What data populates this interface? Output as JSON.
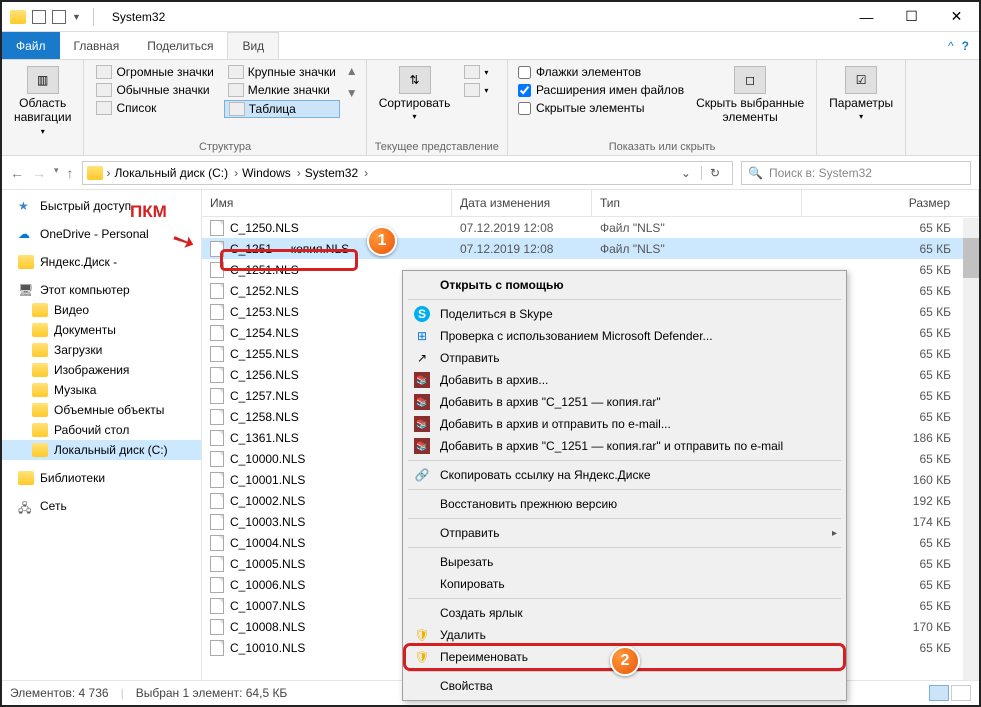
{
  "window": {
    "title": "System32"
  },
  "tabs": {
    "file": "Файл",
    "home": "Главная",
    "share": "Поделиться",
    "view": "Вид"
  },
  "ribbon": {
    "nav_pane": "Область\nнавигации",
    "layout": {
      "huge": "Огромные значки",
      "large": "Крупные значки",
      "normal": "Обычные значки",
      "small": "Мелкие значки",
      "list": "Список",
      "details": "Таблица",
      "label": "Структура"
    },
    "sort": {
      "btn": "Сортировать",
      "label": "Текущее представление"
    },
    "show": {
      "checkboxes": "Флажки элементов",
      "ext": "Расширения имен файлов",
      "hidden": "Скрытые элементы",
      "hide_btn": "Скрыть выбранные\nэлементы",
      "label": "Показать или скрыть"
    },
    "options": "Параметры"
  },
  "breadcrumbs": [
    "Локальный диск (C:)",
    "Windows",
    "System32"
  ],
  "search": {
    "placeholder": "Поиск в: System32"
  },
  "tree": {
    "quick": "Быстрый доступ",
    "onedrive": "OneDrive - Personal",
    "yandex": "Яндекс.Диск -",
    "pc": "Этот компьютер",
    "pc_items": [
      "Видео",
      "Документы",
      "Загрузки",
      "Изображения",
      "Музыка",
      "Объемные объекты",
      "Рабочий стол",
      "Локальный диск (C:)"
    ],
    "libs": "Библиотеки",
    "net": "Сеть"
  },
  "columns": {
    "name": "Имя",
    "date": "Дата изменения",
    "type": "Тип",
    "size": "Размер"
  },
  "files": [
    {
      "n": "C_1250.NLS",
      "d": "07.12.2019 12:08",
      "t": "Файл \"NLS\"",
      "s": "65 КБ",
      "sel": false
    },
    {
      "n": "C_1251 — копия.NLS",
      "d": "07.12.2019 12:08",
      "t": "Файл \"NLS\"",
      "s": "65 КБ",
      "sel": true
    },
    {
      "n": "C_1251.NLS",
      "d": "",
      "t": "",
      "s": "65 КБ"
    },
    {
      "n": "C_1252.NLS",
      "d": "",
      "t": "",
      "s": "65 КБ"
    },
    {
      "n": "C_1253.NLS",
      "d": "",
      "t": "",
      "s": "65 КБ"
    },
    {
      "n": "C_1254.NLS",
      "d": "",
      "t": "",
      "s": "65 КБ"
    },
    {
      "n": "C_1255.NLS",
      "d": "",
      "t": "",
      "s": "65 КБ"
    },
    {
      "n": "C_1256.NLS",
      "d": "",
      "t": "",
      "s": "65 КБ"
    },
    {
      "n": "C_1257.NLS",
      "d": "",
      "t": "",
      "s": "65 КБ"
    },
    {
      "n": "C_1258.NLS",
      "d": "",
      "t": "",
      "s": "65 КБ"
    },
    {
      "n": "C_1361.NLS",
      "d": "",
      "t": "",
      "s": "186 КБ"
    },
    {
      "n": "C_10000.NLS",
      "d": "",
      "t": "",
      "s": "65 КБ"
    },
    {
      "n": "C_10001.NLS",
      "d": "",
      "t": "",
      "s": "160 КБ"
    },
    {
      "n": "C_10002.NLS",
      "d": "",
      "t": "",
      "s": "192 КБ"
    },
    {
      "n": "C_10003.NLS",
      "d": "",
      "t": "",
      "s": "174 КБ"
    },
    {
      "n": "C_10004.NLS",
      "d": "",
      "t": "",
      "s": "65 КБ"
    },
    {
      "n": "C_10005.NLS",
      "d": "",
      "t": "",
      "s": "65 КБ"
    },
    {
      "n": "C_10006.NLS",
      "d": "",
      "t": "",
      "s": "65 КБ"
    },
    {
      "n": "C_10007.NLS",
      "d": "",
      "t": "",
      "s": "65 КБ"
    },
    {
      "n": "C_10008.NLS",
      "d": "",
      "t": "",
      "s": "170 КБ"
    },
    {
      "n": "C_10010.NLS",
      "d": "",
      "t": "",
      "s": "65 КБ"
    }
  ],
  "ctx": {
    "open_with": "Открыть с помощью",
    "skype": "Поделиться в Skype",
    "defender": "Проверка с использованием Microsoft Defender...",
    "send": "Отправить",
    "archive_add": "Добавить в архив...",
    "archive_named": "Добавить в архив \"C_1251 — копия.rar\"",
    "archive_email": "Добавить в архив и отправить по e-mail...",
    "archive_named_email": "Добавить в архив \"C_1251 — копия.rar\" и отправить по e-mail",
    "yandex_link": "Скопировать ссылку на Яндекс.Диске",
    "prev_version": "Восстановить прежнюю версию",
    "send_to": "Отправить",
    "cut": "Вырезать",
    "copy": "Копировать",
    "shortcut": "Создать ярлык",
    "delete": "Удалить",
    "rename": "Переименовать",
    "properties": "Свойства"
  },
  "status": {
    "count": "Элементов: 4 736",
    "sel": "Выбран 1 элемент: 64,5 КБ"
  },
  "annot": {
    "pkm": "ПКМ",
    "b1": "1",
    "b2": "2"
  }
}
